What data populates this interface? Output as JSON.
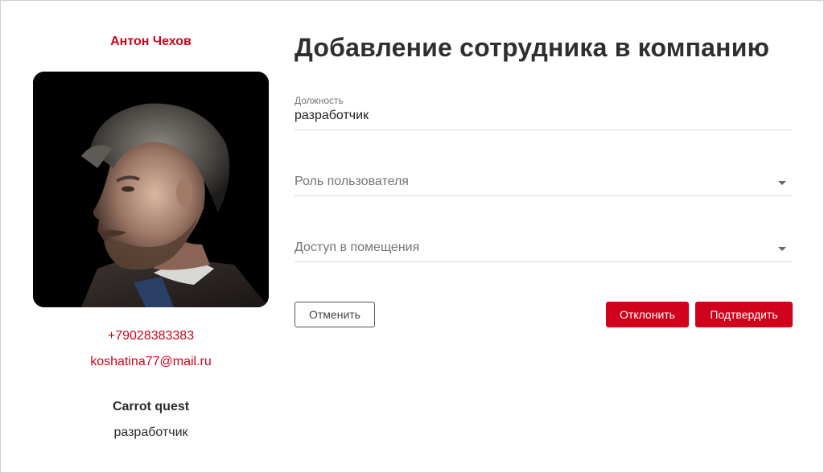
{
  "profile": {
    "name": "Антон Чехов",
    "phone": "+79028383383",
    "email": "koshatina77@mail.ru",
    "company": "Carrot quest",
    "position": "разработчик"
  },
  "form": {
    "title": "Добавление сотрудника в компанию",
    "position_field": {
      "label": "Должность",
      "value": "разработчик"
    },
    "role_select": {
      "placeholder": "Роль пользователя"
    },
    "access_select": {
      "placeholder": "Доступ в помещения"
    }
  },
  "actions": {
    "cancel_label": "Отменить",
    "decline_label": "Отклонить",
    "confirm_label": "Подтвердить"
  },
  "colors": {
    "accent": "#d0021b",
    "text": "#2b2b2b",
    "muted": "#757575",
    "divider": "#d9d9d9"
  }
}
